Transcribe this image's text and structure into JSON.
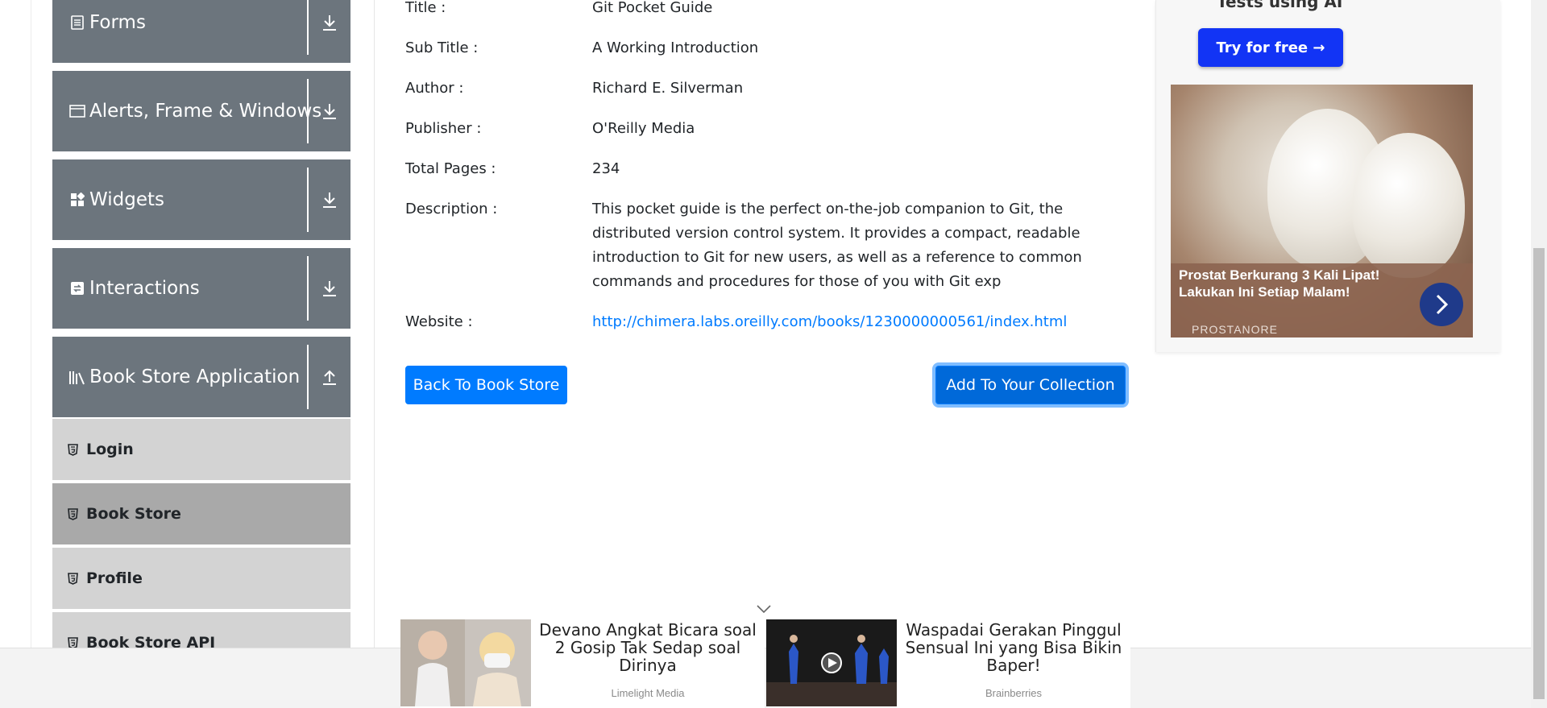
{
  "sidebar": {
    "groups": [
      {
        "label": "Forms",
        "icon": "form-icon",
        "expanded": false
      },
      {
        "label": "Alerts, Frame & Windows",
        "icon": "window-icon",
        "expanded": false
      },
      {
        "label": "Widgets",
        "icon": "widgets-icon",
        "expanded": false
      },
      {
        "label": "Interactions",
        "icon": "interactions-icon",
        "expanded": false
      },
      {
        "label": "Book Store Application",
        "icon": "library-icon",
        "expanded": true
      }
    ],
    "items": [
      {
        "label": "Login",
        "active": false
      },
      {
        "label": "Book Store",
        "active": true
      },
      {
        "label": "Profile",
        "active": false
      },
      {
        "label": "Book Store API",
        "active": false
      }
    ]
  },
  "book": {
    "title_label": "Title :",
    "title": "Git Pocket Guide",
    "subtitle_label": "Sub Title :",
    "subtitle": "A Working Introduction",
    "author_label": "Author :",
    "author": "Richard E. Silverman",
    "publisher_label": "Publisher :",
    "publisher": "O'Reilly Media",
    "pages_label": "Total Pages :",
    "pages": "234",
    "description_label": "Description :",
    "description": "This pocket guide is the perfect on-the-job companion to Git, the distributed version control system. It provides a compact, readable introduction to Git for new users, as well as a reference to common commands and procedures for those of you with Git exp",
    "website_label": "Website :",
    "website": "http://chimera.labs.oreilly.com/books/1230000000561/index.html"
  },
  "actions": {
    "back_label": "Back To Book Store",
    "add_label": "Add To Your Collection"
  },
  "ad": {
    "top_text": "Tests using AI",
    "try_label": "Try for free →",
    "caption": "Prostat Berkurang 3 Kali Lipat! Lakukan Ini Setiap Malam!",
    "brand": "PROSTANORE"
  },
  "native_ads": [
    {
      "title": "Devano Angkat Bicara soal 2 Gosip Tak Sedap soal Dirinya",
      "source": "Limelight Media"
    },
    {
      "title": "Waspadai Gerakan Pinggul Sensual Ini yang Bisa Bikin Baper!",
      "source": "Brainberries"
    }
  ],
  "colors": {
    "accent": "#007bff",
    "group_bg": "#6c757d",
    "item_bg": "#d3d3d3",
    "item_active_bg": "#a9a9a9",
    "ad_button": "#1234f5"
  }
}
